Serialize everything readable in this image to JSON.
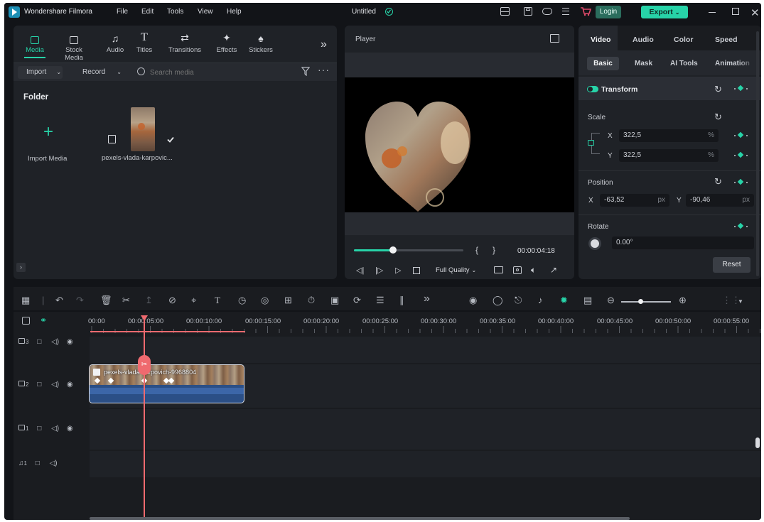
{
  "app": {
    "name": "Wondershare Filmora",
    "project_title": "Untitled"
  },
  "menu": [
    "File",
    "Edit",
    "Tools",
    "View",
    "Help"
  ],
  "header": {
    "login": "Login",
    "export": "Export"
  },
  "media_tabs": [
    {
      "label": "Media",
      "icon": "media-icon",
      "active": true
    },
    {
      "label": "Stock Media",
      "icon": "stock-media-icon"
    },
    {
      "label": "Audio",
      "icon": "music-note-icon"
    },
    {
      "label": "Titles",
      "icon": "title-t-icon"
    },
    {
      "label": "Transitions",
      "icon": "transitions-icon"
    },
    {
      "label": "Effects",
      "icon": "effects-icon"
    },
    {
      "label": "Stickers",
      "icon": "stickers-icon"
    }
  ],
  "media_toolbar": {
    "import": "Import",
    "record": "Record",
    "search_placeholder": "Search media"
  },
  "media_panel": {
    "folder_heading": "Folder",
    "import_label": "Import Media",
    "clip_name": "pexels-vlada-karpovic..."
  },
  "player": {
    "label": "Player",
    "progress": 0.36,
    "timecode": "00:00:04:18",
    "quality": "Full Quality"
  },
  "inspector": {
    "tabs": [
      "Video",
      "Audio",
      "Color",
      "Speed"
    ],
    "active_tab": "Video",
    "subtabs": [
      "Basic",
      "Mask",
      "AI Tools",
      "Animation"
    ],
    "active_subtab": "Basic",
    "transform_label": "Transform",
    "scale": {
      "label": "Scale",
      "x": "322,5",
      "y": "322,5",
      "unit": "%",
      "x_axis": "X",
      "y_axis": "Y"
    },
    "position": {
      "label": "Position",
      "x": "-63,52",
      "y": "-90,46",
      "unit": "px",
      "x_axis": "X",
      "y_axis": "Y"
    },
    "rotate": {
      "label": "Rotate",
      "value": "0.00°"
    },
    "reset": "Reset"
  },
  "timeline": {
    "ruler": [
      "00:00",
      "00:00:05:00",
      "00:00:10:00",
      "00:00:15:00",
      "00:00:20:00",
      "00:00:25:00",
      "00:00:30:00",
      "00:00:35:00",
      "00:00:40:00",
      "00:00:45:00",
      "00:00:50:00",
      "00:00:55:00"
    ],
    "tracks": [
      "3",
      "2",
      "1",
      "1"
    ],
    "clip_label": "pexels-vlada-karpovich-9968804"
  },
  "colors": {
    "accent": "#27d3a8",
    "playhead": "#ef6a6f",
    "clip_border": "#d7dbe4",
    "export_bg": "#27d3a8",
    "login_bg": "#2b6d5d"
  }
}
